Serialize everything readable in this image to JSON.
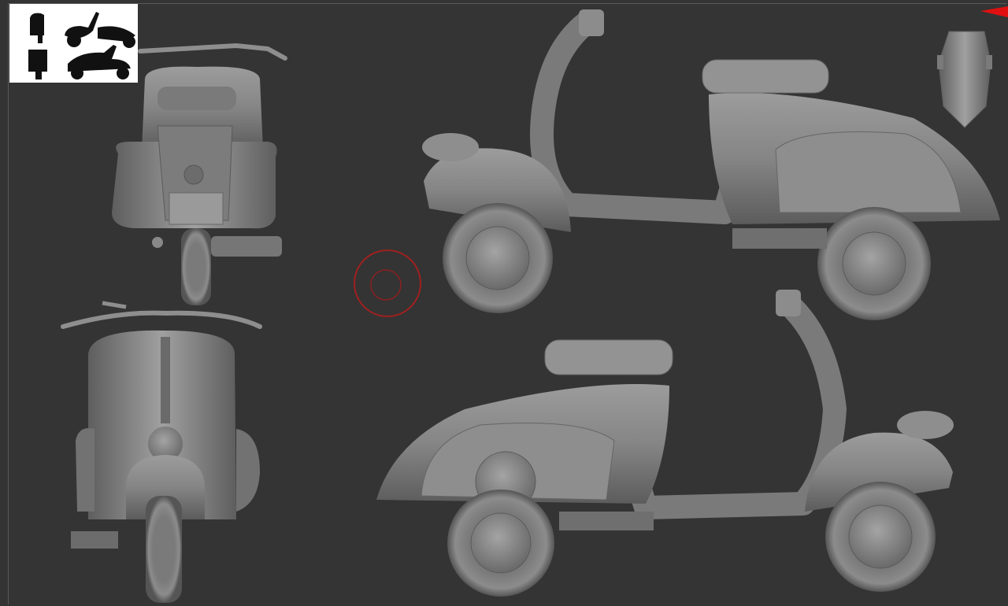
{
  "viewport": {
    "background": "#343434",
    "model_color": "#8a8a8a",
    "brush_cursor_color": "#b02020",
    "view_marker_color": "#e01010"
  },
  "views": [
    {
      "id": "rear",
      "icon": "scooter-rear-view"
    },
    {
      "id": "front",
      "icon": "scooter-front-view"
    },
    {
      "id": "side-left",
      "icon": "scooter-side-view"
    },
    {
      "id": "side-right",
      "icon": "scooter-side-view"
    }
  ],
  "navigator": {
    "icon": "head-navigation-cube"
  },
  "thumbnail": {
    "icon": "scooter-silhouettes"
  }
}
